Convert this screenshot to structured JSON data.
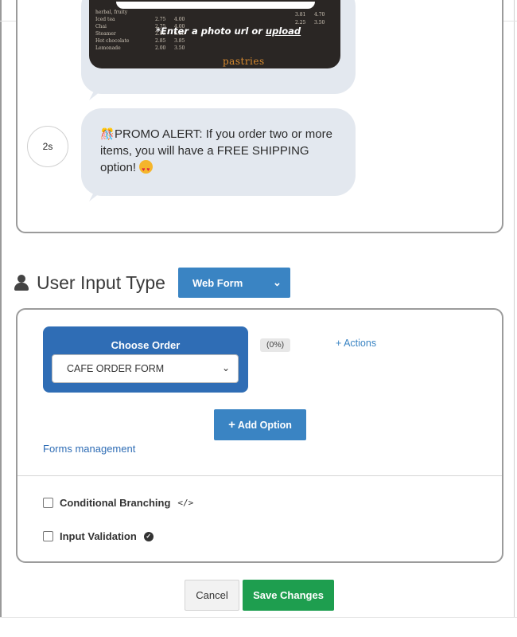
{
  "chat_preview": {
    "menu_image": {
      "rows": [
        {
          "name": "herbal, fruity",
          "price1": "",
          "price2": ""
        },
        {
          "name": "Iced tea",
          "price1": "2.75",
          "price2": "4.00"
        },
        {
          "name": "Chai",
          "price1": "2.75",
          "price2": "4.00"
        },
        {
          "name": "Steamer",
          "price1": "2.85",
          "price2": "3.85"
        },
        {
          "name": "Hot chocolate",
          "price1": "2.85",
          "price2": "3.85"
        },
        {
          "name": "Lemonade",
          "price1": "2.00",
          "price2": "3.50"
        }
      ],
      "right_prices": [
        {
          "a": "3.81",
          "b": "4.70"
        },
        {
          "a": "2.25",
          "b": "3.50"
        }
      ],
      "pastries_label": "pastries"
    },
    "photo_hint_prefix": "*Enter a photo url or ",
    "photo_hint_link": "upload",
    "time_badge": "2s",
    "promo_emoji": "🎊",
    "promo_text": "PROMO ALERT: If you order two or more items, you will have a FREE SHIPPING option! ",
    "promo_end_emoji": "😍"
  },
  "user_input_type": {
    "icon": "user-icon",
    "label": "User Input Type",
    "selected": "Web Form"
  },
  "form_block": {
    "title": "Choose Order",
    "selected_form": "CAFE ORDER FORM",
    "percent": "(0%)",
    "actions_link": "+ Actions",
    "add_option_label": "Add Option",
    "forms_management_link": "Forms management",
    "conditional_branching_label": "Conditional Branching",
    "conditional_branching_checked": false,
    "input_validation_label": "Input Validation",
    "input_validation_checked": false
  },
  "footer": {
    "cancel_label": "Cancel",
    "save_label": "Save Changes"
  },
  "colors": {
    "primary": "#3a84c3",
    "choose_order_bg": "#2f6db5",
    "save_green": "#1e9e4f",
    "bubble_bg": "#e3e8ef"
  }
}
